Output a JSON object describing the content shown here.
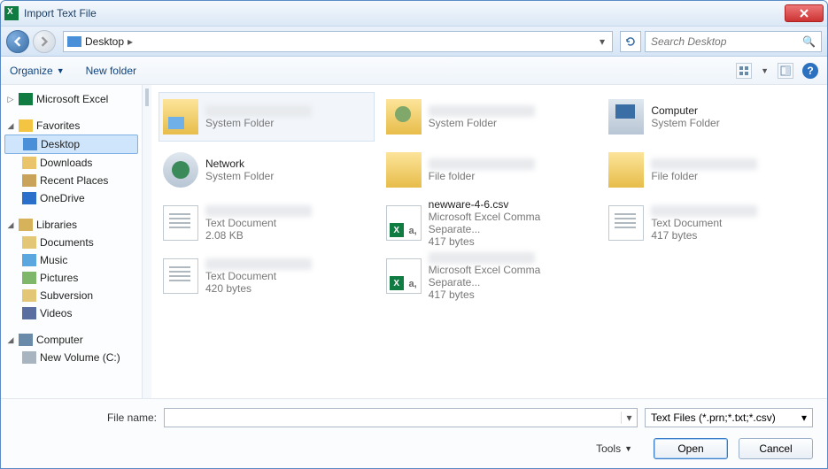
{
  "window": {
    "title": "Import Text File"
  },
  "nav": {
    "location": "Desktop",
    "search_placeholder": "Search Desktop"
  },
  "toolbar": {
    "organize": "Organize",
    "newfolder": "New folder",
    "help": "?"
  },
  "sidebar": {
    "excel": "Microsoft Excel",
    "favorites": "Favorites",
    "fav_items": [
      {
        "label": "Desktop",
        "selected": true,
        "ico": "desktop"
      },
      {
        "label": "Downloads",
        "selected": false,
        "ico": "download"
      },
      {
        "label": "Recent Places",
        "selected": false,
        "ico": "recent"
      },
      {
        "label": "OneDrive",
        "selected": false,
        "ico": "onedrive"
      }
    ],
    "libraries": "Libraries",
    "lib_items": [
      {
        "label": "Documents",
        "ico": "doc"
      },
      {
        "label": "Music",
        "ico": "music"
      },
      {
        "label": "Pictures",
        "ico": "pic"
      },
      {
        "label": "Subversion",
        "ico": "sub"
      },
      {
        "label": "Videos",
        "ico": "vid"
      }
    ],
    "computer": "Computer",
    "comp_items": [
      {
        "label": "New Volume (C:)",
        "ico": "drive"
      }
    ]
  },
  "files": [
    {
      "nameBlur": true,
      "type": "System Folder",
      "size": "",
      "ico": "sysfolder",
      "first": true
    },
    {
      "nameBlur": true,
      "type": "System Folder",
      "size": "",
      "ico": "userfolder"
    },
    {
      "name": "Computer",
      "type": "System Folder",
      "size": "",
      "ico": "computer"
    },
    {
      "name": "Network",
      "type": "System Folder",
      "size": "",
      "ico": "network"
    },
    {
      "nameBlur": true,
      "type": "File folder",
      "size": "",
      "ico": "folder"
    },
    {
      "nameBlur": true,
      "type": "File folder",
      "size": "",
      "ico": "folder"
    },
    {
      "nameBlur": true,
      "type": "Text Document",
      "size": "2.08 KB",
      "ico": "txt"
    },
    {
      "name": "newware-4-6.csv",
      "type": "Microsoft Excel Comma Separate...",
      "size": "417 bytes",
      "ico": "csv"
    },
    {
      "nameBlur": true,
      "type": "Text Document",
      "size": "417 bytes",
      "ico": "txt"
    },
    {
      "nameBlur": true,
      "type": "Text Document",
      "size": "420 bytes",
      "ico": "txt"
    },
    {
      "nameBlur": true,
      "type": "Microsoft Excel Comma Separate...",
      "size": "417 bytes",
      "ico": "csv"
    }
  ],
  "footer": {
    "filename_label": "File name:",
    "filter": "Text Files (*.prn;*.txt;*.csv)",
    "tools": "Tools",
    "open": "Open",
    "cancel": "Cancel"
  }
}
